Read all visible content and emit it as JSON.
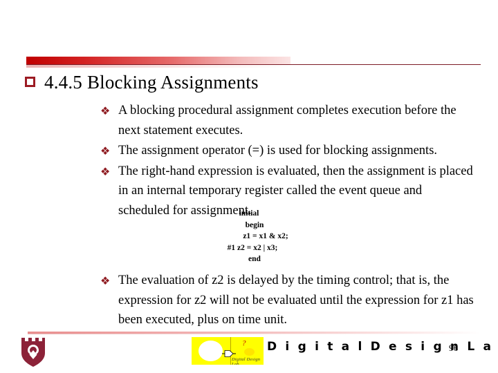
{
  "slide": {
    "title": {
      "bullet_glyph": "square-outline",
      "text": "4.4.5 Blocking Assignments"
    },
    "bullet_glyph": "❖",
    "bullets_upper": [
      "A blocking procedural assignment completes execution before the next statement executes.",
      "The assignment operator (=) is used for blocking assignments.",
      "The right-hand expression is evaluated, then the assignment is placed in an internal temporary register called the event queue and scheduled for assignment."
    ],
    "code_block": [
      {
        "indent": 0,
        "text": "initial"
      },
      {
        "indent": 1,
        "text": "begin"
      },
      {
        "indent": 3,
        "text": "z1 = x1 & x2;"
      },
      {
        "indent": 2,
        "text": "#1 z2 = x2 | x3;"
      },
      {
        "indent": 1,
        "text": "end"
      }
    ],
    "bullets_lower": [
      "The evaluation of z2 is delayed by the timing control; that is, the expression for z2 will not be evaluated until the expression for z1 has been executed, plus on time unit."
    ],
    "footer": {
      "brand": "D i g i t a l   D e s i g n   L a b",
      "logo_caption": "Digital Design Lab",
      "logo_question": "?",
      "page_number": "96"
    },
    "colors": {
      "accent_red": "#c00000",
      "bullet_maroon": "#8f1b21",
      "title_bullet": "#9c1b23",
      "crest_maroon": "#8c2238",
      "logo_yellow": "#ffff00"
    }
  }
}
